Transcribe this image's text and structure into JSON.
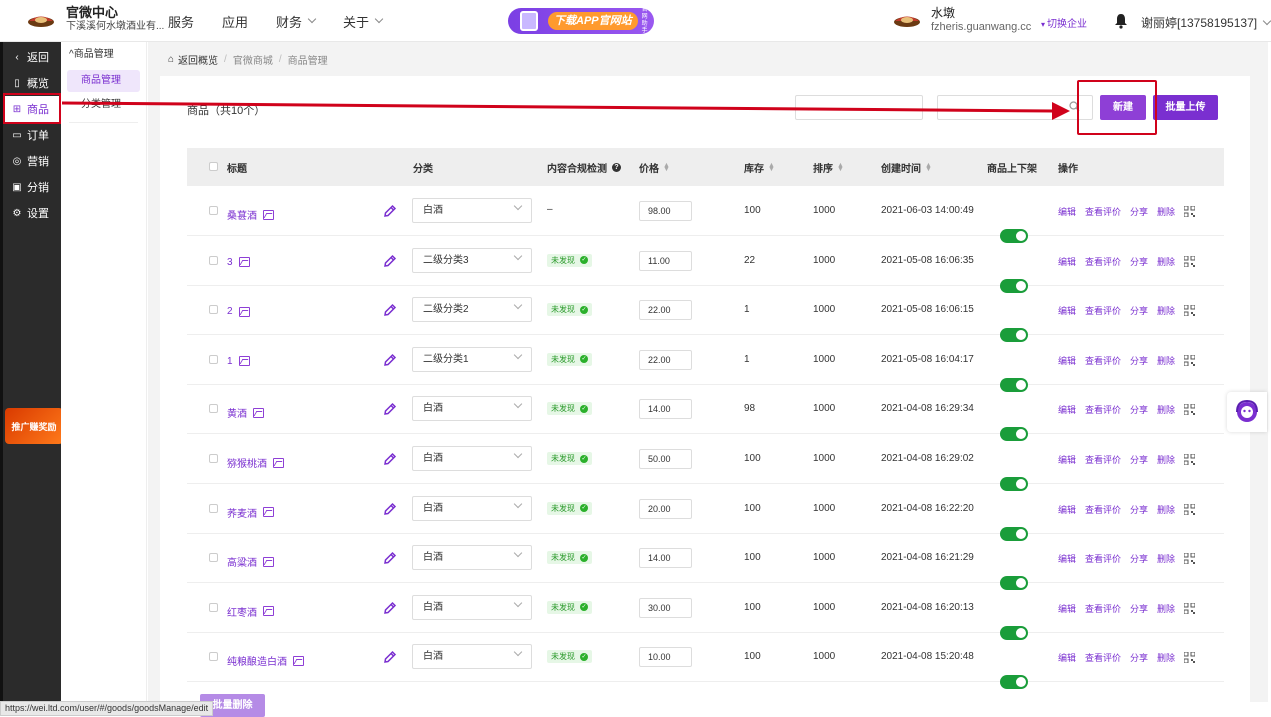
{
  "header": {
    "brand_title": "官微中心",
    "brand_sub": "下溪溪何水墩酒业有...",
    "nav": [
      {
        "label": "服务",
        "has_dropdown": false
      },
      {
        "label": "应用",
        "has_dropdown": false
      },
      {
        "label": "财务",
        "has_dropdown": true
      },
      {
        "label": "关于",
        "has_dropdown": true
      }
    ],
    "promo_label": "下载APP官网站",
    "promo_mini": "官网助手",
    "shop_name": "水墩",
    "shop_domain": "fzheris.guanwang.cc",
    "switch_label": "切换企业",
    "user_label": "谢丽婷[13758195137]"
  },
  "sidebar": {
    "items": [
      {
        "label": "返回",
        "icon": "chevron-left-icon"
      },
      {
        "label": "概览",
        "icon": "overview-icon"
      },
      {
        "label": "商品",
        "icon": "goods-icon",
        "active": true
      },
      {
        "label": "订单",
        "icon": "order-icon"
      },
      {
        "label": "营销",
        "icon": "marketing-icon"
      },
      {
        "label": "分销",
        "icon": "distribution-icon"
      },
      {
        "label": "设置",
        "icon": "gear-icon"
      }
    ],
    "promo": "推广赚奖励"
  },
  "subnav": {
    "head": "商品管理",
    "items": [
      {
        "label": "商品管理",
        "active": true
      },
      {
        "label": "分类管理",
        "active": false
      }
    ]
  },
  "breadcrumb": {
    "home": "返回概览",
    "items": [
      "官微商城",
      "商品管理"
    ]
  },
  "toolbar": {
    "count_label": "商品（共10个）",
    "new_label": "新建",
    "upload_label": "批量上传"
  },
  "table": {
    "headers": {
      "title": "标题",
      "category": "分类",
      "compliance": "内容合规检测",
      "price": "价格",
      "stock": "库存",
      "sort": "排序",
      "created": "创建时间",
      "shelf": "商品上下架",
      "ops": "操作"
    },
    "ops_labels": [
      "编辑",
      "查看评价",
      "分享",
      "删除"
    ],
    "rows": [
      {
        "title": "桑葚酒",
        "category": "白酒",
        "compliance": "–",
        "price": "98.00",
        "stock": "100",
        "sort": "1000",
        "created": "2021-06-03 14:00:49",
        "on_shelf": true
      },
      {
        "title": "3",
        "category": "二级分类3",
        "compliance": "未发现",
        "price": "11.00",
        "stock": "22",
        "sort": "1000",
        "created": "2021-05-08 16:06:35",
        "on_shelf": true
      },
      {
        "title": "2",
        "category": "二级分类2",
        "compliance": "未发现",
        "price": "22.00",
        "stock": "1",
        "sort": "1000",
        "created": "2021-05-08 16:06:15",
        "on_shelf": true
      },
      {
        "title": "1",
        "category": "二级分类1",
        "compliance": "未发现",
        "price": "22.00",
        "stock": "1",
        "sort": "1000",
        "created": "2021-05-08 16:04:17",
        "on_shelf": true
      },
      {
        "title": "黄酒",
        "category": "白酒",
        "compliance": "未发现",
        "price": "14.00",
        "stock": "98",
        "sort": "1000",
        "created": "2021-04-08 16:29:34",
        "on_shelf": true
      },
      {
        "title": "猕猴桃酒",
        "category": "白酒",
        "compliance": "未发现",
        "price": "50.00",
        "stock": "100",
        "sort": "1000",
        "created": "2021-04-08 16:29:02",
        "on_shelf": true
      },
      {
        "title": "荞麦酒",
        "category": "白酒",
        "compliance": "未发现",
        "price": "20.00",
        "stock": "100",
        "sort": "1000",
        "created": "2021-04-08 16:22:20",
        "on_shelf": true
      },
      {
        "title": "高粱酒",
        "category": "白酒",
        "compliance": "未发现",
        "price": "14.00",
        "stock": "100",
        "sort": "1000",
        "created": "2021-04-08 16:21:29",
        "on_shelf": true
      },
      {
        "title": "红枣酒",
        "category": "白酒",
        "compliance": "未发现",
        "price": "30.00",
        "stock": "100",
        "sort": "1000",
        "created": "2021-04-08 16:20:13",
        "on_shelf": true
      },
      {
        "title": "纯粮酿造白酒",
        "category": "白酒",
        "compliance": "未发现",
        "price": "10.00",
        "stock": "100",
        "sort": "1000",
        "created": "2021-04-08 15:20:48",
        "on_shelf": true
      }
    ]
  },
  "footer": {
    "bulk_delete": "批量删除",
    "status_url": "https://wei.ltd.com/user/#/goods/goodsManage/edit"
  },
  "colors": {
    "accent": "#7a2fd0",
    "toggle_on": "#1a9d3a",
    "highlight": "#d0021b"
  }
}
